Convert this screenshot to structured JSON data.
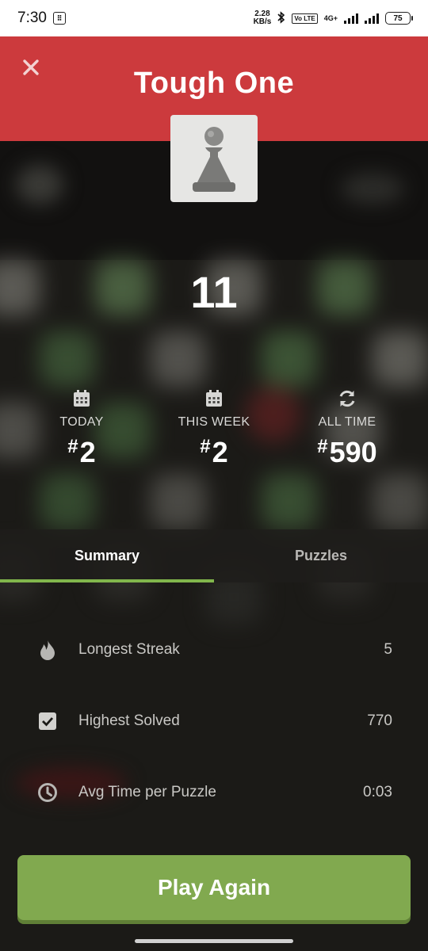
{
  "status_bar": {
    "time": "7:30",
    "net_speed_value": "2.28",
    "net_speed_unit": "KB/s",
    "volte": "Vo LTE",
    "network": "4G+",
    "battery": "75"
  },
  "header": {
    "title": "Tough One",
    "close_icon": "close-icon",
    "color": "#cc3a3d"
  },
  "result": {
    "piece_icon": "pawn-icon",
    "score": "11"
  },
  "ranks": {
    "today": {
      "label": "TODAY",
      "hash": "#",
      "value": "2",
      "icon": "calendar-icon"
    },
    "week": {
      "label": "THIS WEEK",
      "hash": "#",
      "value": "2",
      "icon": "calendar-icon"
    },
    "all_time": {
      "label": "ALL TIME",
      "hash": "#",
      "value": "590",
      "icon": "refresh-icon"
    }
  },
  "tabs": [
    {
      "label": "Summary",
      "active": true
    },
    {
      "label": "Puzzles",
      "active": false
    }
  ],
  "summary": {
    "longest_streak": {
      "label": "Longest Streak",
      "value": "5",
      "icon": "flame-icon"
    },
    "highest_solved": {
      "label": "Highest Solved",
      "value": "770",
      "icon": "checkbox-icon"
    },
    "avg_time": {
      "label": "Avg Time per Puzzle",
      "value": "0:03",
      "icon": "clock-icon"
    }
  },
  "play_again": {
    "label": "Play Again",
    "color": "#81a94f"
  },
  "accent": "#81b64c"
}
